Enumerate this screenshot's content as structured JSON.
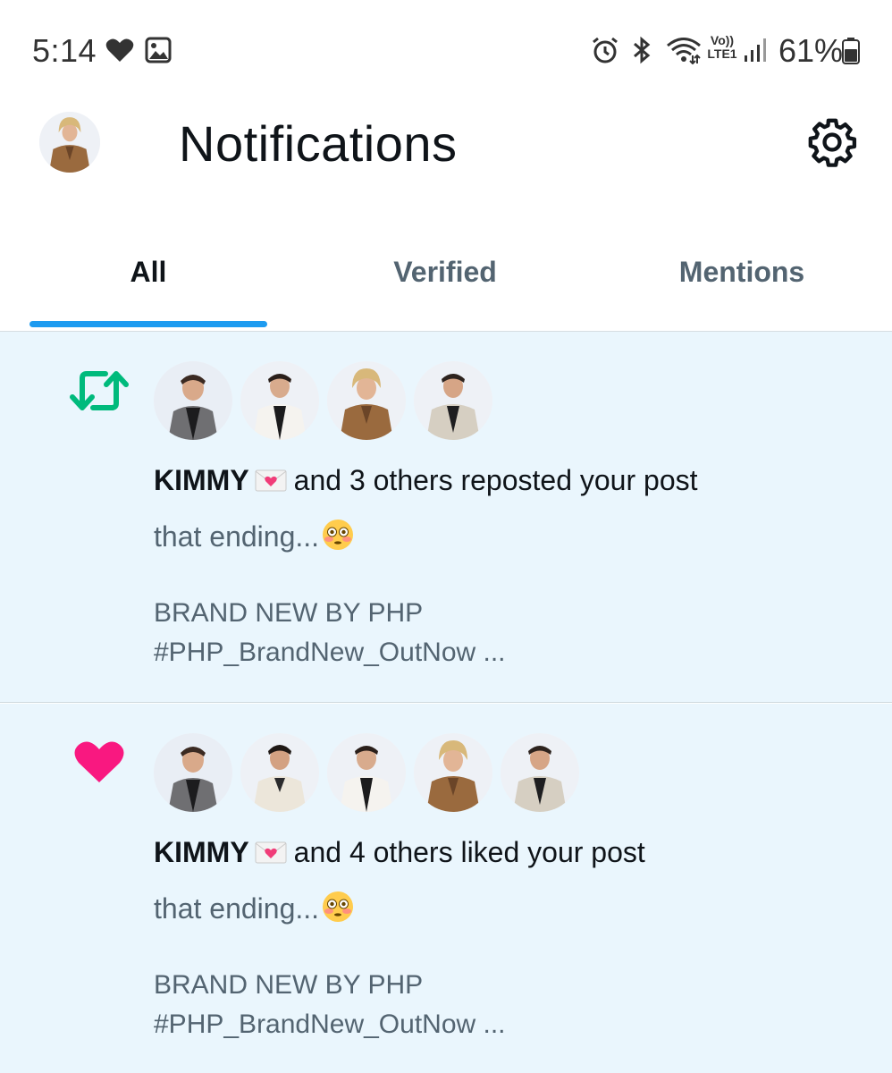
{
  "status_bar": {
    "time": "5:14",
    "network_label_top": "Vo))",
    "network_label_bottom": "LTE1",
    "battery_percent": "61%",
    "icons": [
      "heart-icon",
      "gallery-icon",
      "alarm-icon",
      "bluetooth-icon",
      "wifi-icon",
      "volte-icon",
      "signal-icon",
      "battery-icon"
    ]
  },
  "header": {
    "title": "Notifications",
    "avatar_icon": "profile-avatar",
    "settings_icon": "gear-icon"
  },
  "tabs": [
    {
      "label": "All",
      "active": true
    },
    {
      "label": "Verified",
      "active": false
    },
    {
      "label": "Mentions",
      "active": false
    }
  ],
  "colors": {
    "accent": "#1d9bf0",
    "repost": "#00ba7c",
    "like": "#f91880",
    "row_background": "#eaf6fd"
  },
  "notifications": [
    {
      "type": "repost",
      "icon": "repost-icon",
      "avatar_count": 4,
      "actor": "KIMMY",
      "actor_emoji": "love-letter-emoji",
      "action_text": "and 3 others reposted your post",
      "post_preview": "that ending...",
      "post_emoji": "flushed-face-emoji",
      "post_line2": "BRAND NEW BY PHP",
      "post_line3": "#PHP_BrandNew_OutNow ..."
    },
    {
      "type": "like",
      "icon": "heart-icon",
      "avatar_count": 5,
      "actor": "KIMMY",
      "actor_emoji": "love-letter-emoji",
      "action_text": "and 4 others liked your post",
      "post_preview": "that ending...",
      "post_emoji": "flushed-face-emoji",
      "post_line2": "BRAND NEW BY PHP",
      "post_line3": "#PHP_BrandNew_OutNow ..."
    }
  ]
}
